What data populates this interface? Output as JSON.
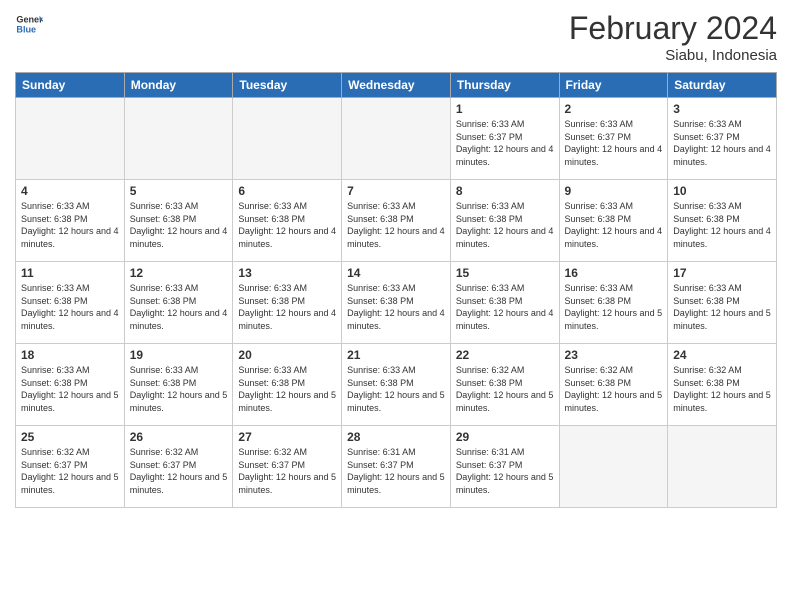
{
  "header": {
    "logo_general": "General",
    "logo_blue": "Blue",
    "month_title": "February 2024",
    "location": "Siabu, Indonesia"
  },
  "days_of_week": [
    "Sunday",
    "Monday",
    "Tuesday",
    "Wednesday",
    "Thursday",
    "Friday",
    "Saturday"
  ],
  "weeks": [
    [
      {
        "num": "",
        "empty": true
      },
      {
        "num": "",
        "empty": true
      },
      {
        "num": "",
        "empty": true
      },
      {
        "num": "",
        "empty": true
      },
      {
        "num": "1",
        "sunrise": "6:33 AM",
        "sunset": "6:37 PM",
        "daylight": "12 hours and 4 minutes."
      },
      {
        "num": "2",
        "sunrise": "6:33 AM",
        "sunset": "6:37 PM",
        "daylight": "12 hours and 4 minutes."
      },
      {
        "num": "3",
        "sunrise": "6:33 AM",
        "sunset": "6:37 PM",
        "daylight": "12 hours and 4 minutes."
      }
    ],
    [
      {
        "num": "4",
        "sunrise": "6:33 AM",
        "sunset": "6:38 PM",
        "daylight": "12 hours and 4 minutes."
      },
      {
        "num": "5",
        "sunrise": "6:33 AM",
        "sunset": "6:38 PM",
        "daylight": "12 hours and 4 minutes."
      },
      {
        "num": "6",
        "sunrise": "6:33 AM",
        "sunset": "6:38 PM",
        "daylight": "12 hours and 4 minutes."
      },
      {
        "num": "7",
        "sunrise": "6:33 AM",
        "sunset": "6:38 PM",
        "daylight": "12 hours and 4 minutes."
      },
      {
        "num": "8",
        "sunrise": "6:33 AM",
        "sunset": "6:38 PM",
        "daylight": "12 hours and 4 minutes."
      },
      {
        "num": "9",
        "sunrise": "6:33 AM",
        "sunset": "6:38 PM",
        "daylight": "12 hours and 4 minutes."
      },
      {
        "num": "10",
        "sunrise": "6:33 AM",
        "sunset": "6:38 PM",
        "daylight": "12 hours and 4 minutes."
      }
    ],
    [
      {
        "num": "11",
        "sunrise": "6:33 AM",
        "sunset": "6:38 PM",
        "daylight": "12 hours and 4 minutes."
      },
      {
        "num": "12",
        "sunrise": "6:33 AM",
        "sunset": "6:38 PM",
        "daylight": "12 hours and 4 minutes."
      },
      {
        "num": "13",
        "sunrise": "6:33 AM",
        "sunset": "6:38 PM",
        "daylight": "12 hours and 4 minutes."
      },
      {
        "num": "14",
        "sunrise": "6:33 AM",
        "sunset": "6:38 PM",
        "daylight": "12 hours and 4 minutes."
      },
      {
        "num": "15",
        "sunrise": "6:33 AM",
        "sunset": "6:38 PM",
        "daylight": "12 hours and 4 minutes."
      },
      {
        "num": "16",
        "sunrise": "6:33 AM",
        "sunset": "6:38 PM",
        "daylight": "12 hours and 5 minutes."
      },
      {
        "num": "17",
        "sunrise": "6:33 AM",
        "sunset": "6:38 PM",
        "daylight": "12 hours and 5 minutes."
      }
    ],
    [
      {
        "num": "18",
        "sunrise": "6:33 AM",
        "sunset": "6:38 PM",
        "daylight": "12 hours and 5 minutes."
      },
      {
        "num": "19",
        "sunrise": "6:33 AM",
        "sunset": "6:38 PM",
        "daylight": "12 hours and 5 minutes."
      },
      {
        "num": "20",
        "sunrise": "6:33 AM",
        "sunset": "6:38 PM",
        "daylight": "12 hours and 5 minutes."
      },
      {
        "num": "21",
        "sunrise": "6:33 AM",
        "sunset": "6:38 PM",
        "daylight": "12 hours and 5 minutes."
      },
      {
        "num": "22",
        "sunrise": "6:32 AM",
        "sunset": "6:38 PM",
        "daylight": "12 hours and 5 minutes."
      },
      {
        "num": "23",
        "sunrise": "6:32 AM",
        "sunset": "6:38 PM",
        "daylight": "12 hours and 5 minutes."
      },
      {
        "num": "24",
        "sunrise": "6:32 AM",
        "sunset": "6:38 PM",
        "daylight": "12 hours and 5 minutes."
      }
    ],
    [
      {
        "num": "25",
        "sunrise": "6:32 AM",
        "sunset": "6:37 PM",
        "daylight": "12 hours and 5 minutes."
      },
      {
        "num": "26",
        "sunrise": "6:32 AM",
        "sunset": "6:37 PM",
        "daylight": "12 hours and 5 minutes."
      },
      {
        "num": "27",
        "sunrise": "6:32 AM",
        "sunset": "6:37 PM",
        "daylight": "12 hours and 5 minutes."
      },
      {
        "num": "28",
        "sunrise": "6:31 AM",
        "sunset": "6:37 PM",
        "daylight": "12 hours and 5 minutes."
      },
      {
        "num": "29",
        "sunrise": "6:31 AM",
        "sunset": "6:37 PM",
        "daylight": "12 hours and 5 minutes."
      },
      {
        "num": "",
        "empty": true
      },
      {
        "num": "",
        "empty": true
      }
    ]
  ],
  "labels": {
    "sunrise": "Sunrise:",
    "sunset": "Sunset:",
    "daylight": "Daylight:"
  }
}
